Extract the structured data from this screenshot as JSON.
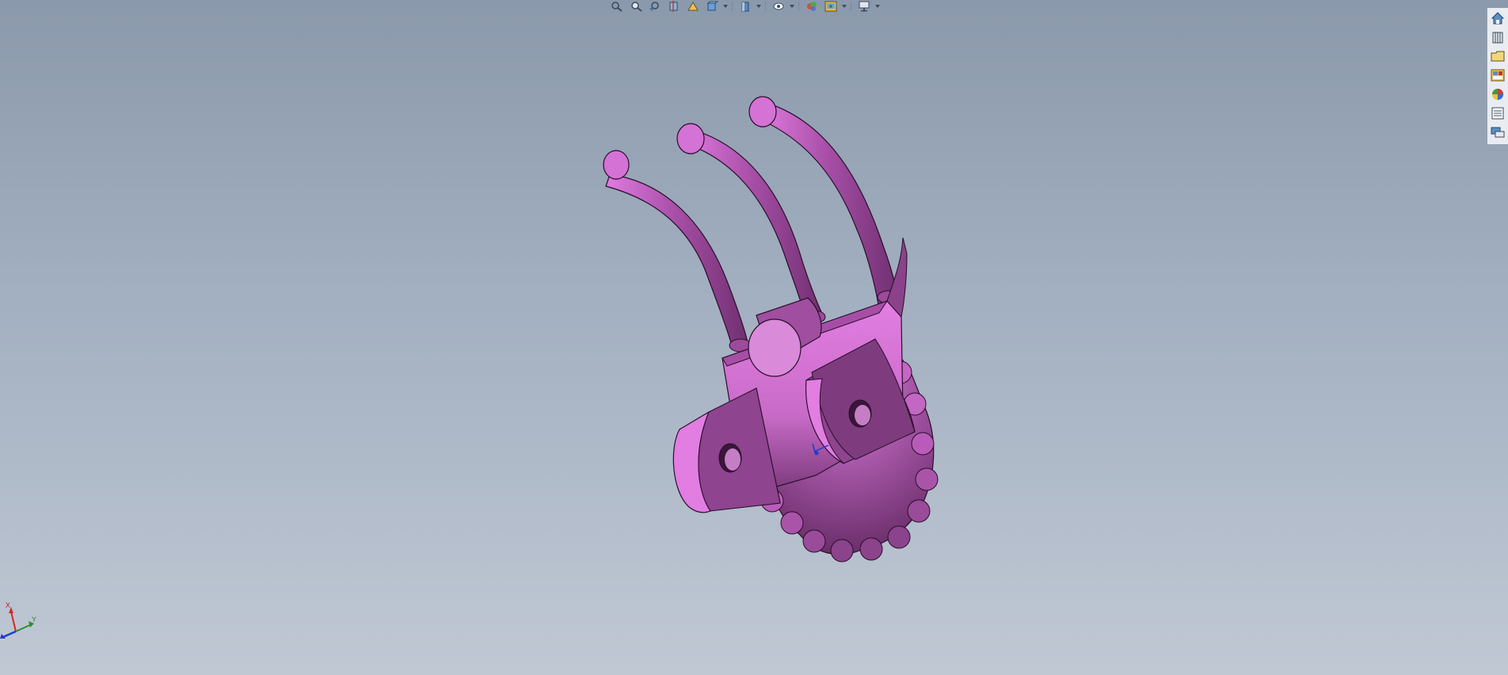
{
  "hud": {
    "buttons": [
      {
        "name": "zoom-to-fit-icon"
      },
      {
        "name": "zoom-to-area-icon"
      },
      {
        "name": "previous-view-icon"
      },
      {
        "name": "section-view-icon"
      },
      {
        "name": "dynamic-annotation-icon"
      },
      {
        "name": "view-orientation-icon"
      },
      {
        "name": "display-style-icon"
      },
      {
        "name": "hide-show-items-icon"
      },
      {
        "name": "edit-appearance-icon"
      },
      {
        "name": "apply-scene-icon"
      },
      {
        "name": "view-settings-icon"
      }
    ]
  },
  "taskpane": {
    "items": [
      {
        "name": "solidworks-resources-icon"
      },
      {
        "name": "design-library-icon"
      },
      {
        "name": "file-explorer-icon"
      },
      {
        "name": "view-palette-icon"
      },
      {
        "name": "appearances-scenes-icon"
      },
      {
        "name": "custom-properties-icon"
      },
      {
        "name": "forum-icon"
      }
    ]
  },
  "triad": {
    "x_label": "X",
    "y_label": "Y",
    "z_label": "Z"
  },
  "colors": {
    "part": "#c865c8",
    "part_dark": "#7a3a7a",
    "part_light": "#e680e6",
    "background_top": "#8a99ab",
    "background_bottom": "#c0c8d4"
  }
}
